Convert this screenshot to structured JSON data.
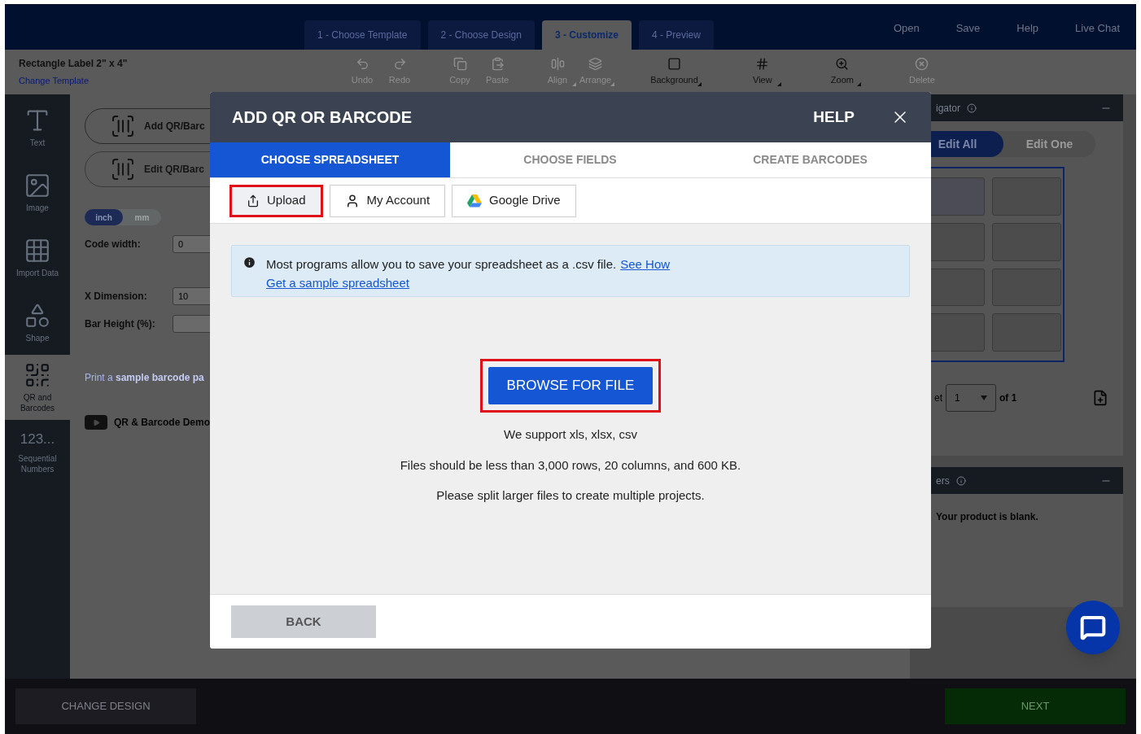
{
  "header": {
    "steps": [
      {
        "label": "1 - Choose Template",
        "selected": false
      },
      {
        "label": "2 - Choose Design",
        "selected": false
      },
      {
        "label": "3 - Customize",
        "selected": true
      },
      {
        "label": "4 - Preview",
        "selected": false
      }
    ],
    "links": [
      "Open",
      "Save",
      "Help",
      "Live Chat"
    ]
  },
  "toolbar": {
    "template_title": "Rectangle Label 2\" x 4\"",
    "change_template": "Change Template",
    "groups": [
      [
        {
          "kind": "undo",
          "label": "Undo",
          "disabled": true,
          "dropdown": false
        },
        {
          "kind": "redo",
          "label": "Redo",
          "disabled": true,
          "dropdown": false
        }
      ],
      [
        {
          "kind": "copy",
          "label": "Copy",
          "disabled": true,
          "dropdown": false
        },
        {
          "kind": "paste",
          "label": "Paste",
          "disabled": true,
          "dropdown": false
        }
      ],
      [
        {
          "kind": "align",
          "label": "Align",
          "disabled": true,
          "dropdown": true
        },
        {
          "kind": "arrange",
          "label": "Arrange",
          "disabled": true,
          "dropdown": true
        }
      ],
      [
        {
          "kind": "background",
          "label": "Background",
          "disabled": false,
          "dropdown": true
        }
      ],
      [
        {
          "kind": "view",
          "label": "View",
          "disabled": false,
          "dropdown": true
        }
      ],
      [
        {
          "kind": "zoom",
          "label": "Zoom",
          "disabled": false,
          "dropdown": true
        }
      ],
      [
        {
          "kind": "delete",
          "label": "Delete",
          "disabled": true,
          "dropdown": false
        }
      ]
    ]
  },
  "sidebar": {
    "items": [
      {
        "kind": "text",
        "label": "Text",
        "selected": false
      },
      {
        "kind": "image",
        "label": "Image",
        "selected": false
      },
      {
        "kind": "import",
        "label": "Import Data",
        "selected": false
      },
      {
        "kind": "shape",
        "label": "Shape",
        "selected": false
      },
      {
        "kind": "qr",
        "label": "QR and Barcodes",
        "selected": true
      },
      {
        "kind": "numbers",
        "label": "Sequential Numbers",
        "icon_text": "123...",
        "selected": false
      }
    ]
  },
  "panel": {
    "add_button": "Add QR/Barc",
    "edit_button": "Edit QR/Barc",
    "units": [
      {
        "label": "inch",
        "selected": true
      },
      {
        "label": "mm",
        "selected": false
      }
    ],
    "fields": [
      {
        "label": "Code width:",
        "value": "0"
      },
      {
        "label": "X Dimension:",
        "value": "10"
      },
      {
        "label": "Bar Height (%):"
      }
    ],
    "print_link": "Print a **sample barcode pa**",
    "demo_link": "QR & Barcode Demo"
  },
  "navigator": {
    "title": "igator",
    "modes": [
      {
        "label": "Edit All",
        "selected": true
      },
      {
        "label": "Edit One",
        "selected": false
      }
    ],
    "sheet_label": "et",
    "sheet_value": "1",
    "sheet_total": "of 1"
  },
  "layers": {
    "title": "ers",
    "empty": "Your product is blank."
  },
  "dialog": {
    "title": "ADD QR OR BARCODE",
    "help": "HELP",
    "tabs": [
      {
        "label": "CHOOSE SPREADSHEET",
        "selected": true
      },
      {
        "label": "CHOOSE FIELDS",
        "selected": false
      },
      {
        "label": "CREATE BARCODES",
        "selected": false
      }
    ],
    "sources": [
      {
        "kind": "upload",
        "label": "Upload",
        "selected": true
      },
      {
        "kind": "account",
        "label": "My Account",
        "selected": false
      },
      {
        "kind": "drive",
        "label": "Google Drive",
        "selected": false
      }
    ],
    "info": "Most programs allow you to save your spreadsheet as a .csv file.",
    "see_how": "See How",
    "sample_link": "Get a sample spreadsheet",
    "browse": {
      "label": "BROWSE FOR FILE",
      "highlighted": true
    },
    "notes": [
      "We support xls, xlsx, csv",
      "Files should be less than 3,000 rows, 20 columns, and 600 KB.",
      "Please split larger files to create multiple projects."
    ],
    "back": "BACK"
  },
  "footer": {
    "change_design": "CHANGE DESIGN",
    "next": "NEXT"
  }
}
